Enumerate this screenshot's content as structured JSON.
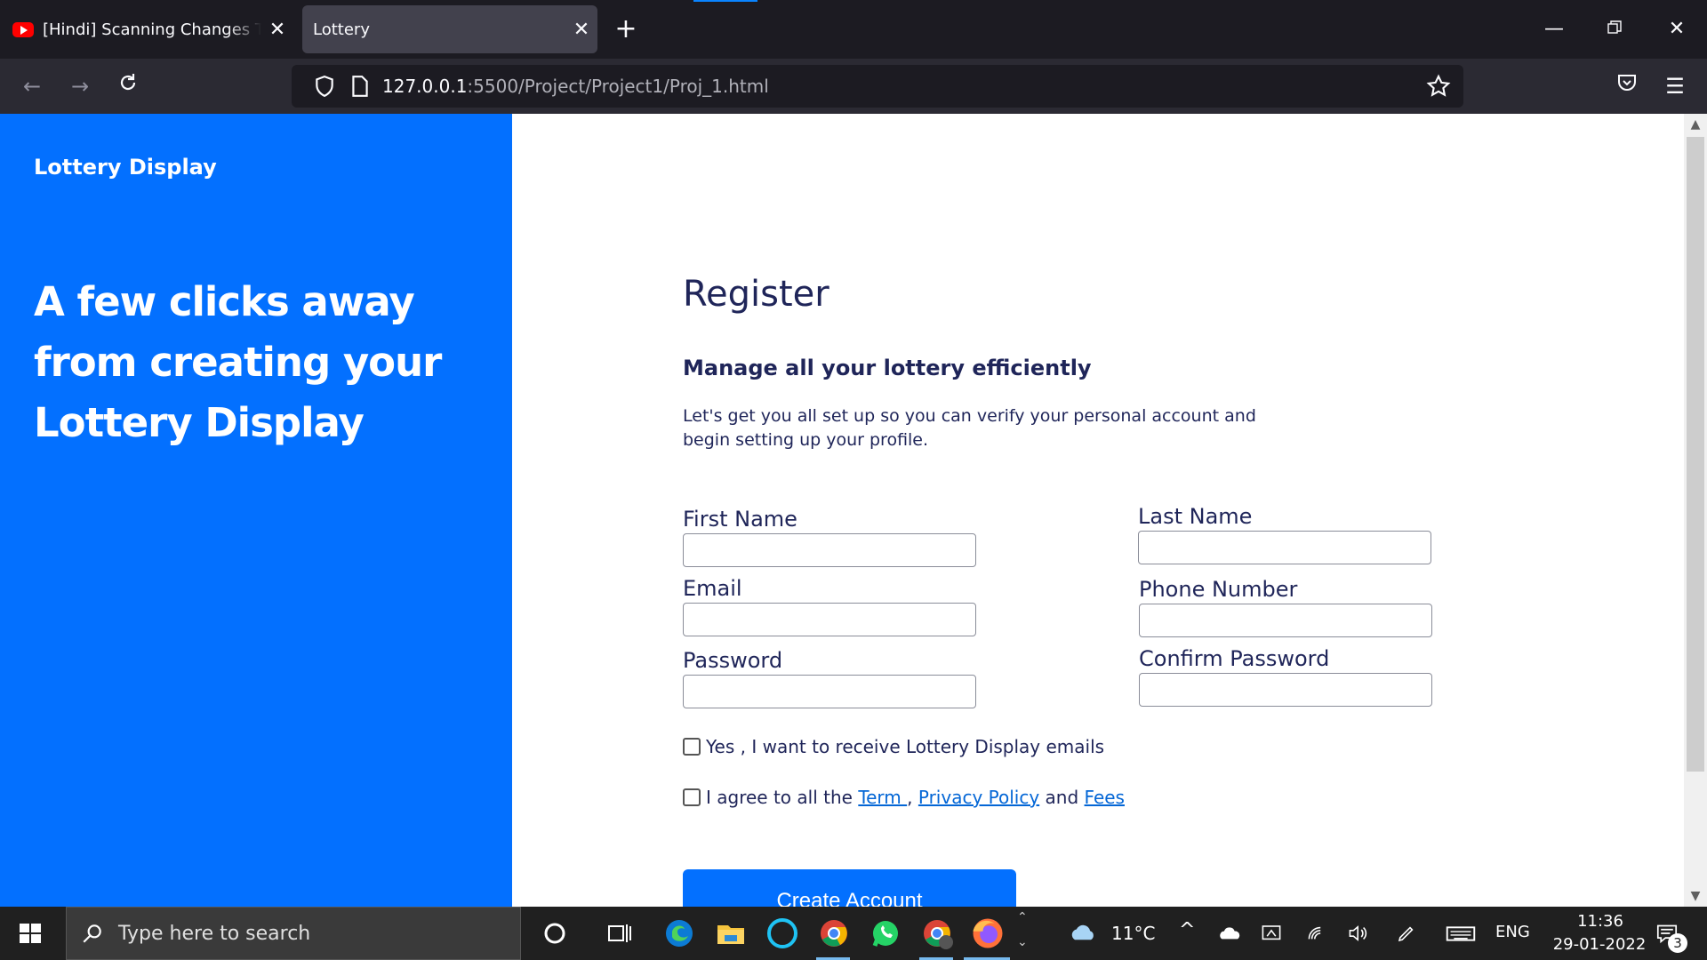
{
  "browser": {
    "tabs": [
      {
        "title": "[Hindi] Scanning Changes To Fil",
        "active": false,
        "icon": "youtube-icon"
      },
      {
        "title": "Lottery",
        "active": true
      }
    ],
    "url_host": "127.0.0.1",
    "url_path": ":5500/Project/Project1/Proj_1.html"
  },
  "page": {
    "brand": "Lottery Display",
    "hero": "A few clicks away from creating your Lottery Display",
    "title": "Register",
    "subtitle": "Manage all your lottery efficiently",
    "description": "Let's get you all set up so you can verify your personal account and begin setting up your profile.",
    "fields": {
      "first_name": "First Name",
      "last_name": "Last Name",
      "email": "Email",
      "phone": "Phone Number",
      "password": "Password",
      "confirm_password": "Confirm Password"
    },
    "checkbox_emails": "Yes , I want to receive Lottery Display emails",
    "agree_prefix": "I agree to all the ",
    "agree_term": "Term ",
    "agree_comma": ", ",
    "agree_privacy": "Privacy Policy",
    "agree_and": " and ",
    "agree_fees": "Fees",
    "create_button": "Create Account",
    "colors": {
      "primary": "#0370ff",
      "text": "#1f2559",
      "link": "#0366d6"
    }
  },
  "taskbar": {
    "search_placeholder": "Type here to search",
    "weather": "11°C",
    "language": "ENG",
    "time": "11:36",
    "date": "29-01-2022",
    "notifications": "3"
  }
}
